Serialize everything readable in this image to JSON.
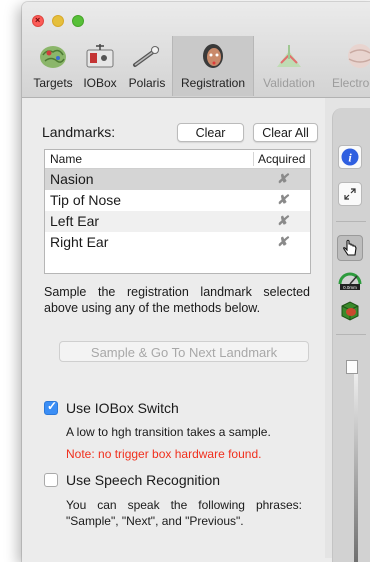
{
  "tabs": [
    {
      "label": "Targets",
      "icon": "brain-targets-icon",
      "state": "normal"
    },
    {
      "label": "IOBox",
      "icon": "iobox-icon",
      "state": "normal"
    },
    {
      "label": "Polaris",
      "icon": "polaris-pointer-icon",
      "state": "normal"
    },
    {
      "label": "Registration",
      "icon": "head-registration-icon",
      "state": "selected"
    },
    {
      "label": "Validation",
      "icon": "validation-icon",
      "state": "disabled"
    },
    {
      "label": "Electroc",
      "icon": "electrode-icon",
      "state": "disabled"
    }
  ],
  "landmarks": {
    "title": "Landmarks:",
    "clear_label": "Clear",
    "clear_all_label": "Clear All",
    "columns": {
      "name": "Name",
      "acquired": "Acquired"
    },
    "rows": [
      {
        "name": "Nasion",
        "acquired": "✘",
        "selected": true
      },
      {
        "name": "Tip of Nose",
        "acquired": "✘",
        "selected": false
      },
      {
        "name": "Left Ear",
        "acquired": "✘",
        "selected": false
      },
      {
        "name": "Right Ear",
        "acquired": "✘",
        "selected": false
      }
    ]
  },
  "instructions": "Sample the registration landmark selected above using any of the methods below.",
  "sample_button": "Sample & Go To Next Landmark",
  "iobox_switch": {
    "label": "Use IOBox Switch",
    "checked": true,
    "hint": "A low to hgh transition takes a sample.",
    "warning": "Note: no trigger box hardware found."
  },
  "speech": {
    "label": "Use Speech Recognition",
    "checked": false,
    "hint": "You can speak the following phrases: \"Sample\", \"Next\", and \"Previous\"."
  },
  "toolbar": {
    "icons": [
      "info-icon",
      "expand-icon",
      "hand-pointer-icon",
      "gauge-icon",
      "3d-cube-icon"
    ],
    "gauge_text": "0.0mm"
  },
  "colors": {
    "accent": "#3b8ef5",
    "warning": "#f0301e",
    "selected_row": "#d5d5d5"
  }
}
